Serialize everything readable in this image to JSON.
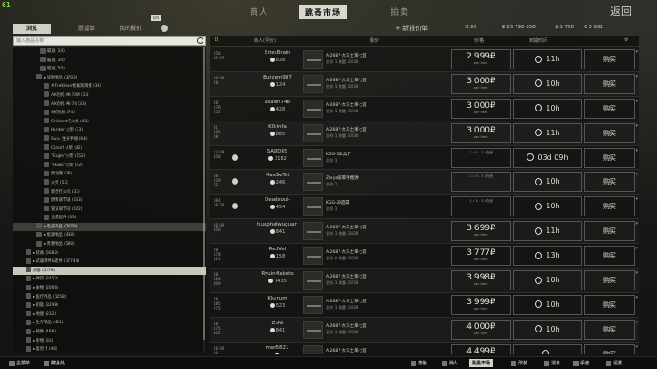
{
  "fps": "61",
  "nav": {
    "traders": "商人",
    "flea_market": "跳蚤市场",
    "hideout": "拍卖",
    "back": "返回"
  },
  "left_tabs": {
    "browse": "浏览",
    "wishlist": "愿望单",
    "my_offers": "我的报价",
    "badge": "0/5"
  },
  "search": {
    "placeholder": "输入物品名称"
  },
  "header": {
    "add_offer": "+ 新报价单",
    "rep": "3.88",
    "rubles": "₽ 25 798 658",
    "dollars": "$ 3 766",
    "euros": "€ 3 661",
    "col_id": "ID",
    "col_trader": "商人(评价)",
    "col_item": "报价",
    "col_price": "价格",
    "col_expire": "到期时间"
  },
  "tree": [
    {
      "label": "瞄准 (34)",
      "indent": 30
    },
    {
      "label": "瞄准 (34)",
      "indent": 30
    },
    {
      "label": "瞄准 (50)",
      "indent": 30
    },
    {
      "label": "▸ 战利物品 (3793)",
      "indent": 26
    },
    {
      "label": "#FireKlean枪械润滑液 (36)",
      "indent": 34
    },
    {
      "label": "AK枪机 AK-74M (33)",
      "indent": 34
    },
    {
      "label": "AK枪机 AK-74 (33)",
      "indent": 34
    },
    {
      "label": "S枪机枪 (74)",
      "indent": 34
    },
    {
      "label": "Crickent打火机 (42)",
      "indent": 34
    },
    {
      "label": "Hunter 火柴 (33)",
      "indent": 34
    },
    {
      "label": "Surv. 生存手册 (64)",
      "indent": 34
    },
    {
      "label": "Classif 火柴 (42)",
      "indent": 34
    },
    {
      "label": "\"Eagle\"火柴 (152)",
      "indent": 34
    },
    {
      "label": "\"Hawk\"火柴 (42)",
      "indent": 34
    },
    {
      "label": "柴油罐 (38)",
      "indent": 34
    },
    {
      "label": "火柴 (53)",
      "indent": 34
    },
    {
      "label": "新型打火机 (33)",
      "indent": 34
    },
    {
      "label": "燃料调节器 (183)",
      "indent": 34
    },
    {
      "label": "管道调节剂 (162)",
      "indent": 34
    },
    {
      "label": "金属配件 (33)",
      "indent": 34
    },
    {
      "label": "▸ 电子产品 (2479)",
      "indent": 26,
      "hl": true
    },
    {
      "label": "▸ 能源物品 (438)",
      "indent": 26
    },
    {
      "label": "▸ 贵重物品 (588)",
      "indent": 26
    },
    {
      "label": "▸ 装备 (5682)",
      "indent": 14
    },
    {
      "label": "▸ 武器零件&配件 (17744)",
      "indent": 14
    },
    {
      "label": "武器 (5278)",
      "indent": 14,
      "sel": true
    },
    {
      "label": "▸ 弹药 (2452)",
      "indent": 14
    },
    {
      "label": "▸ 食物 (2066)",
      "indent": 14
    },
    {
      "label": "▸ 医疗用品 (1258)",
      "indent": 14
    },
    {
      "label": "▸ 钥匙 (3298)",
      "indent": 14
    },
    {
      "label": "▸ 地图 (232)",
      "indent": 14
    },
    {
      "label": "▸ 生存物品 (411)",
      "indent": 14
    },
    {
      "label": "▸ 特殊 (188)",
      "indent": 14
    },
    {
      "label": "▸ 杂物 (33)",
      "indent": 14
    },
    {
      "label": "▸ 鉴别卡 (46)",
      "indent": 14
    }
  ],
  "offers": [
    {
      "id": "256 09 97",
      "trader": "EriesBrain",
      "rating": "838",
      "req": "A-2687-大马士革七首",
      "req2": "总价 1  数量 30/30",
      "price": "2 999₽",
      "sub": "per item",
      "expire": "11h",
      "buy": "购买",
      "exch": false,
      "alt": false
    },
    {
      "id": "28 09 28",
      "trader": "Burzum987",
      "rating": "124",
      "req": "A-2687-大马士革七首",
      "req2": "总价 1  数量 30/30",
      "price": "3 000₽",
      "sub": "per item",
      "expire": "10h",
      "buy": "购买",
      "exch": false,
      "alt": true
    },
    {
      "id": "28 178 252",
      "trader": "asasin748",
      "rating": "428",
      "req": "A-2687-大马士革七首",
      "req2": "总价 1  数量 30/30",
      "price": "3 000₽",
      "sub": "per item",
      "expire": "10h",
      "buy": "购买",
      "exch": false,
      "alt": false
    },
    {
      "id": "81 185 28",
      "trader": "K0rinfa",
      "rating": "885",
      "req": "A-2687-大马士革七首",
      "req2": "总价 1  数量 30/30",
      "price": "3 000₽",
      "sub": "per item",
      "expire": "11h",
      "buy": "购买",
      "exch": false,
      "alt": true
    },
    {
      "id": "13 08 858",
      "trader": "SADDIIS",
      "rating": "2182",
      "req": "KGG-5伞兵铲",
      "req2": "总价 1",
      "price": "",
      "sub": "2 × 5 - 3-6在面",
      "expire": "03d 09h",
      "buy": "购买",
      "exch": true,
      "alt": false
    },
    {
      "id": "28 239 52",
      "trader": "MaxGeTat",
      "rating": "246",
      "req": "Zarya眩晕手榴弹",
      "req2": "总价 1",
      "price": "",
      "sub": "1 × 5 - 3-6在面",
      "expire": "10h",
      "buy": "购买",
      "exch": true,
      "alt": true
    },
    {
      "id": "584 08 28",
      "trader": "Deadsoul-",
      "rating": "454",
      "req": "KGG-20面罩",
      "req2": "总价 1",
      "price": "",
      "sub": "1 × 5 - 3-6在面",
      "expire": "10h",
      "buy": "购买",
      "exch": true,
      "alt": false
    },
    {
      "id": "28 09 356",
      "trader": "huaphelwuguan",
      "rating": "841",
      "req": "A-2687-大马士革七首",
      "req2": "总价 1  数量 30/30",
      "price": "3 699₽",
      "sub": "per item",
      "expire": "11h",
      "buy": "购买",
      "exch": false,
      "alt": true
    },
    {
      "id": "28 178 121",
      "trader": "RedVel",
      "rating": "158",
      "req": "A-2687-大马士革七首",
      "req2": "总价 2  数量 30/30",
      "price": "3 777₽",
      "sub": "per item",
      "expire": "13h",
      "buy": "购买",
      "exch": false,
      "alt": false
    },
    {
      "id": "28 565 309",
      "trader": "RyuinMakoto",
      "rating": "3435",
      "req": "A-2687-大马士革七首",
      "req2": "总价 1  数量 30/30",
      "price": "3 998₽",
      "sub": "per item",
      "expire": "10h",
      "buy": "购买",
      "exch": false,
      "alt": true
    },
    {
      "id": "28 185 775",
      "trader": "Kkarum",
      "rating": "523",
      "req": "A-2687-大马士革七首",
      "req2": "总价 1  数量 30/30",
      "price": "3 999₽",
      "sub": "per item",
      "expire": "10h",
      "buy": "购买",
      "exch": false,
      "alt": false
    },
    {
      "id": "28 175 102",
      "trader": "ZuNi",
      "rating": "841",
      "req": "A-2687-大马士革七首",
      "req2": "总价 1  数量 30/30",
      "price": "4 000₽",
      "sub": "per item",
      "expire": "10h",
      "buy": "购买",
      "exch": false,
      "alt": true
    },
    {
      "id": "28 09 28",
      "trader": "mer5821",
      "rating": "",
      "req": "A-2687-大马士革七首",
      "req2": "",
      "price": "4 499₽",
      "sub": "",
      "expire": "",
      "buy": "购买",
      "exch": false,
      "alt": false
    }
  ],
  "bottom": {
    "main_menu": "主菜单",
    "hideout": "藏身处",
    "character": "角色",
    "traders": "商人",
    "flea": "跳蚤市场",
    "builds": "改装",
    "messenger": "消息",
    "handbook": "手册",
    "settings": "设置"
  }
}
